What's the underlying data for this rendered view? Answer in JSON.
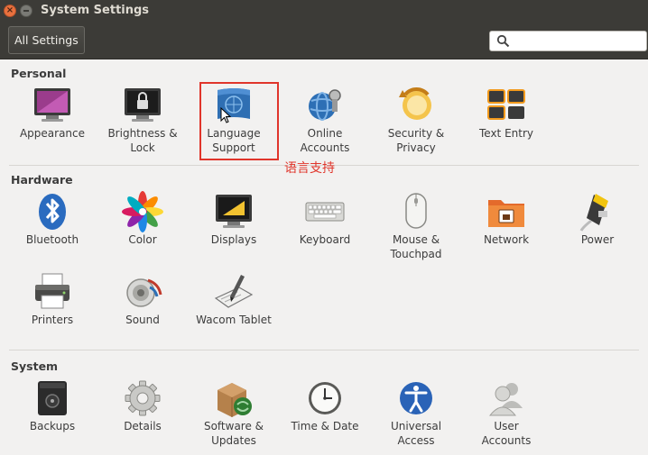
{
  "window": {
    "title": "System Settings",
    "close_glyph": "×"
  },
  "toolbar": {
    "all_settings_label": "All Settings",
    "search_placeholder": "",
    "search_value": ""
  },
  "annotation": {
    "text": "语言支持",
    "color": "#e0352b"
  },
  "sections": {
    "personal": {
      "title": "Personal",
      "items": [
        {
          "id": "appearance",
          "lines": [
            "Appearance",
            ""
          ],
          "icon": "appearance-icon"
        },
        {
          "id": "brightness-lock",
          "lines": [
            "Brightness &",
            "Lock"
          ],
          "icon": "brightness-lock-icon"
        },
        {
          "id": "language-support",
          "lines": [
            "Language",
            "Support"
          ],
          "icon": "language-support-icon"
        },
        {
          "id": "online-accounts",
          "lines": [
            "Online",
            "Accounts"
          ],
          "icon": "online-accounts-icon"
        },
        {
          "id": "security-privacy",
          "lines": [
            "Security &",
            "Privacy"
          ],
          "icon": "security-privacy-icon"
        },
        {
          "id": "text-entry",
          "lines": [
            "Text Entry",
            ""
          ],
          "icon": "text-entry-icon"
        }
      ]
    },
    "hardware": {
      "title": "Hardware",
      "items": [
        {
          "id": "bluetooth",
          "lines": [
            "Bluetooth",
            ""
          ],
          "icon": "bluetooth-icon"
        },
        {
          "id": "color",
          "lines": [
            "Color",
            ""
          ],
          "icon": "color-icon"
        },
        {
          "id": "displays",
          "lines": [
            "Displays",
            ""
          ],
          "icon": "displays-icon"
        },
        {
          "id": "keyboard",
          "lines": [
            "Keyboard",
            ""
          ],
          "icon": "keyboard-icon"
        },
        {
          "id": "mouse-touchpad",
          "lines": [
            "Mouse &",
            "Touchpad"
          ],
          "icon": "mouse-icon"
        },
        {
          "id": "network",
          "lines": [
            "Network",
            ""
          ],
          "icon": "network-icon"
        },
        {
          "id": "power",
          "lines": [
            "Power",
            ""
          ],
          "icon": "power-icon"
        },
        {
          "id": "printers",
          "lines": [
            "Printers",
            ""
          ],
          "icon": "printer-icon"
        },
        {
          "id": "sound",
          "lines": [
            "Sound",
            ""
          ],
          "icon": "sound-icon"
        },
        {
          "id": "wacom-tablet",
          "lines": [
            "Wacom Tablet",
            ""
          ],
          "icon": "wacom-tablet-icon"
        }
      ]
    },
    "system": {
      "title": "System",
      "items": [
        {
          "id": "backups",
          "lines": [
            "Backups",
            ""
          ],
          "icon": "backups-icon"
        },
        {
          "id": "details",
          "lines": [
            "Details",
            ""
          ],
          "icon": "details-gear-icon"
        },
        {
          "id": "software-updates",
          "lines": [
            "Software &",
            "Updates"
          ],
          "icon": "software-updates-icon"
        },
        {
          "id": "time-date",
          "lines": [
            "Time & Date",
            ""
          ],
          "icon": "clock-icon"
        },
        {
          "id": "universal-access",
          "lines": [
            "Universal",
            "Access"
          ],
          "icon": "universal-access-icon"
        },
        {
          "id": "user-accounts",
          "lines": [
            "User",
            "Accounts"
          ],
          "icon": "user-accounts-icon"
        }
      ]
    }
  }
}
